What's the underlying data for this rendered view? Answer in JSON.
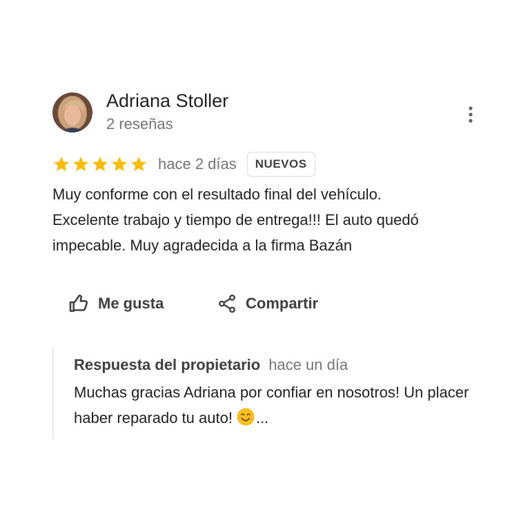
{
  "review": {
    "author_name": "Adriana Stoller",
    "author_meta": "2 reseñas",
    "avatar_icon": "profile-photo",
    "more_icon": "more-vert-icon",
    "rating": 5,
    "rating_max": 5,
    "star_color": "#fbbc04",
    "time": "hace 2 días",
    "badge": "NUEVOS",
    "text": "Muy conforme con el resultado final del vehículo.\nExcelente trabajo y tiempo de entrega!!! El auto quedó\nimpecable.  Muy agradecida a la firma Bazán"
  },
  "actions": {
    "like_label": "Me gusta",
    "like_icon": "thumb-up-icon",
    "share_label": "Compartir",
    "share_icon": "share-icon"
  },
  "owner_reply": {
    "title": "Respuesta del propietario",
    "time": "hace un día",
    "text": "Muchas gracias Adriana por confiar en nosotros! Un placer haber reparado tu auto!",
    "emoji_icon": "smiling-face-emoji",
    "ellipsis": "..."
  }
}
